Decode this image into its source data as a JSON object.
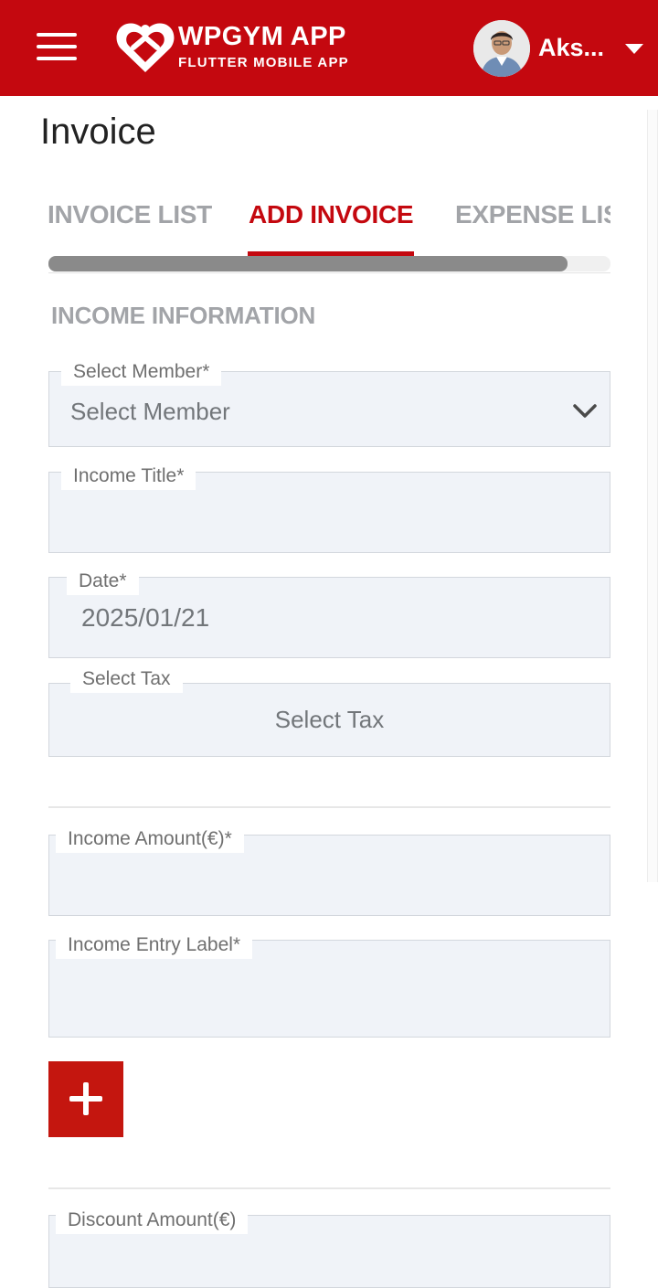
{
  "header": {
    "logo_title": "WPGYM APP",
    "logo_subtitle": "FLUTTER MOBILE APP",
    "user_name": "Aks...",
    "icons": [
      "menu-icon",
      "logo-heart-icon",
      "avatar",
      "caret-down-icon"
    ]
  },
  "page": {
    "title": "Invoice"
  },
  "tabs": [
    {
      "label": "INVOICE LIST",
      "active": false
    },
    {
      "label": "ADD INVOICE",
      "active": true
    },
    {
      "label": "EXPENSE LIST",
      "active": false
    }
  ],
  "form": {
    "section_title": "INCOME INFORMATION",
    "select_member": {
      "label": "Select Member*",
      "value": "Select Member"
    },
    "income_title": {
      "label": "Income Title*",
      "value": ""
    },
    "date": {
      "label": "Date*",
      "value": "2025/01/21"
    },
    "select_tax": {
      "label": "Select Tax",
      "value": "Select Tax"
    },
    "income_amount": {
      "label": "Income Amount(€)*",
      "value": ""
    },
    "income_entry_label": {
      "label": "Income Entry Label*",
      "value": ""
    },
    "add_entry_button": "plus-icon",
    "discount_amount": {
      "label": "Discount Amount(€)",
      "value": ""
    }
  },
  "colors": {
    "brand": "#c4080f",
    "field_background": "#f0f3f8",
    "muted_text": "#a2a4a8"
  }
}
